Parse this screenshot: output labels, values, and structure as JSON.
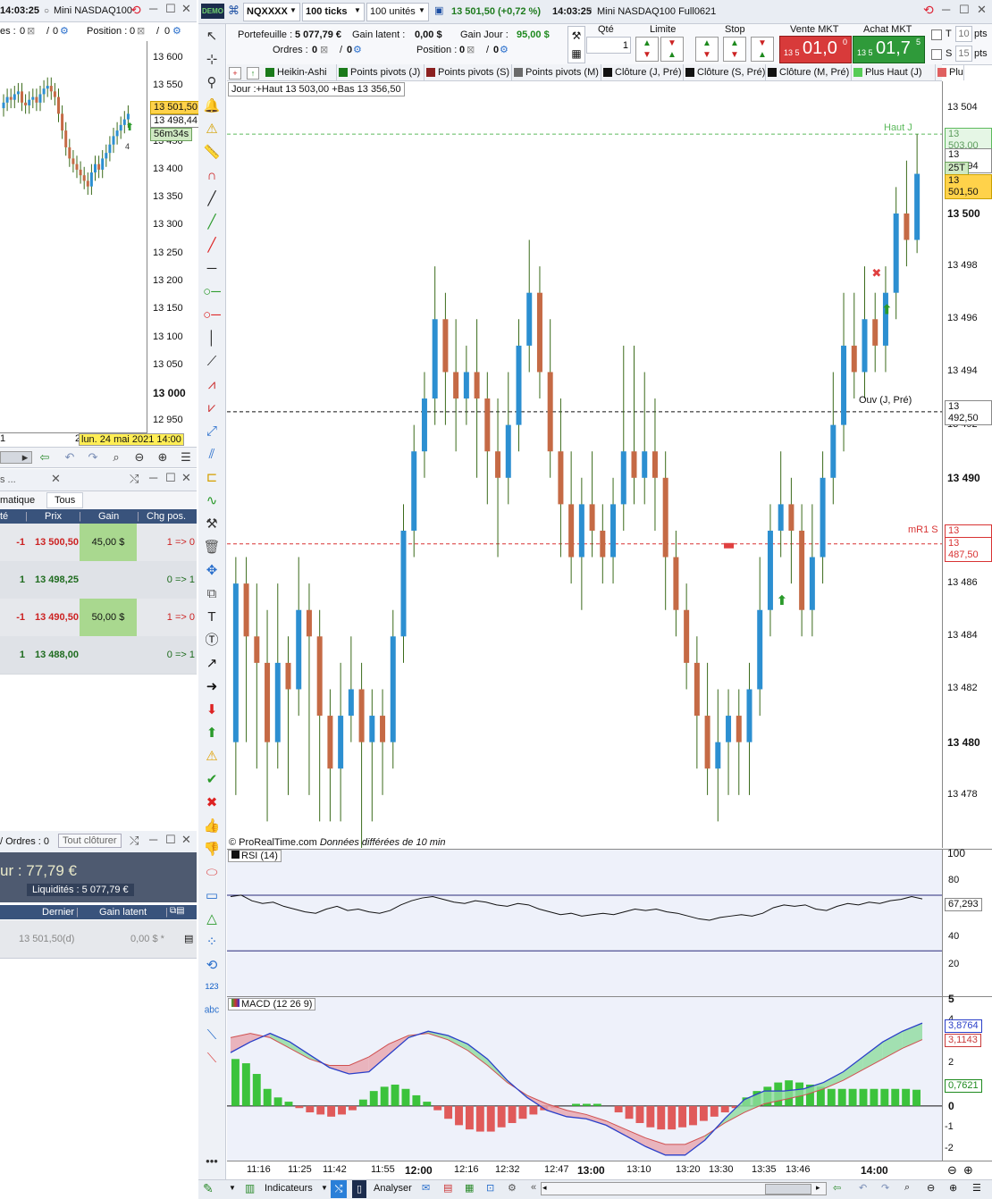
{
  "left_window": {
    "time": "14:03:25",
    "title": "Mini NASDAQ100",
    "orders_label": "es :",
    "orders_val": "0",
    "slash": "/",
    "orders2": "0",
    "position_label": "Position :",
    "position_val": "0",
    "position2": "0",
    "price_labels": [
      "13 600",
      "13 550",
      "13 500",
      "13 450",
      "13 400",
      "13 350",
      "13 300",
      "13 250",
      "13 200",
      "13 150",
      "13 100",
      "13 050",
      "13 000",
      "12 950"
    ],
    "last_price": "13 501,50",
    "ref_price": "13 498,44",
    "countdown": "56m34s",
    "date_badge": "lun. 24 mai 2021 14:00",
    "x_left": "1",
    "x_right": "2",
    "marker_num": "4"
  },
  "trades_panel": {
    "title": "s ...",
    "filter_auto": "matique",
    "filter_all": "Tous",
    "headers": [
      "té",
      "Prix",
      "Gain",
      "Chg pos."
    ],
    "rows": [
      {
        "qty": "-1",
        "price": "13 500,50",
        "gain": "45,00 $",
        "chg": "1 => 0"
      },
      {
        "qty": "1",
        "price": "13 498,25",
        "gain": "",
        "chg": "0 => 1"
      },
      {
        "qty": "-1",
        "price": "13 490,50",
        "gain": "50,00 $",
        "chg": "1 => 0"
      },
      {
        "qty": "1",
        "price": "13 488,00",
        "gain": "",
        "chg": "0 => 1"
      }
    ]
  },
  "positions_panel": {
    "orders_label": "/ Ordres : 0",
    "close_all": "Tout clôturer",
    "day_gain": "ur : 77,79 €",
    "liquidity": "Liquidités : 5 077,79 €",
    "headers": [
      "Dernier",
      "Gain latent"
    ],
    "row": {
      "last": "13 501,50(d)",
      "gain": "0,00 $ *"
    }
  },
  "main_toolbar": {
    "demo": "DEMO",
    "symbol": "NQXXXX",
    "ticks": "100 ticks",
    "units": "100 unités",
    "price_change": "13 501,50 (+0,72 %)",
    "time": "14:03:25",
    "title": "Mini NASDAQ100 Full0621"
  },
  "portfolio": {
    "portefeuille_label": "Portefeuille :",
    "portefeuille_val": "5 077,79 €",
    "gain_latent_label": "Gain latent :",
    "gain_latent_val": "0,00 $",
    "gain_jour_label": "Gain Jour :",
    "gain_jour_val": "95,00 $",
    "ordres_label": "Ordres :",
    "ordres_val": "0",
    "ordres2": "0",
    "position_label": "Position :",
    "position_val": "0",
    "position2": "0",
    "qte_label": "Qté",
    "qte_val": "1",
    "limite_label": "Limite",
    "stop_label": "Stop",
    "vente_label": "Vente MKT",
    "vente_small": "13 5",
    "vente_big": "01,0",
    "vente_sup": "0",
    "achat_label": "Achat MKT",
    "achat_small": "13 5",
    "achat_big": "01,7",
    "achat_sup": "5",
    "t_label": "T",
    "t_val": "10",
    "t_unit": "pts",
    "s_label": "S",
    "s_val": "15",
    "s_unit": "pts"
  },
  "indicator_tabs": [
    "Heikin-Ashi",
    "Points pivots (J)",
    "Points pivots (S)",
    "Points pivots (M)",
    "Clôture (J, Pré)",
    "Clôture (S, Pré)",
    "Clôture (M, Pré)",
    "Plus Haut (J)",
    "Plu"
  ],
  "tab_colors": [
    "#1a7a1a",
    "#1a7a1a",
    "#8b2020",
    "#6b6b6b",
    "#111111",
    "#111111",
    "#111111",
    "#55cc55",
    "#e06060"
  ],
  "main_chart": {
    "info": "Jour :+Haut 13 503,00 +Bas 13 356,50",
    "watermark": "© ProRealTime.com",
    "delay": "Données différées de 10 min",
    "haut_label": "Haut J",
    "ouv_label": "Ouv (J, Pré)",
    "mr1_label": "mR1 S",
    "price_axis": [
      "13 504",
      "13 500",
      "13 498",
      "13 496",
      "13 494",
      "13 492",
      "13 490",
      "13 488",
      "13 486",
      "13 484",
      "13 482",
      "13 480",
      "13 478"
    ],
    "bold_prices": [
      "13 500",
      "13 490",
      "13 480"
    ],
    "badges": {
      "haut": "13 503,00",
      "last": "13 501,94",
      "ticks": "25T",
      "price": "13 501,50",
      "ouv": "13 492,50",
      "mr1a": "13 487,50",
      "mr1b": "13 487,50"
    },
    "time_axis": [
      "11:16",
      "11:25",
      "11:42",
      "11:55",
      "12:00",
      "12:16",
      "12:32",
      "12:47",
      "13:00",
      "13:10",
      "13:20",
      "13:30",
      "13:35",
      "13:46",
      "14:00"
    ],
    "bold_times": [
      "12:00",
      "13:00",
      "14:00"
    ]
  },
  "rsi_panel": {
    "label": "RSI (14)",
    "axis": [
      "100",
      "80",
      "60",
      "40",
      "20"
    ],
    "value": "67,293"
  },
  "macd_panel": {
    "label": "MACD (12 26 9)",
    "axis": [
      "5",
      "4",
      "3",
      "2",
      "1",
      "0",
      "-1",
      "-2"
    ],
    "v1": "3,8764",
    "v2": "3,1143",
    "v3": "0,7621"
  },
  "bottom_bar": {
    "indicators": "Indicateurs",
    "analyze": "Analyser"
  },
  "chart_data": {
    "type": "candlestick",
    "title": "Mini NASDAQ100 Full0621",
    "ylim": [
      13476,
      13505
    ],
    "x_labels": [
      "11:16",
      "11:25",
      "11:42",
      "11:55",
      "12:00",
      "12:16",
      "12:32",
      "12:47",
      "13:00",
      "13:10",
      "13:20",
      "13:30",
      "13:35",
      "13:46",
      "14:00"
    ],
    "levels": {
      "haut_j": 13503.0,
      "ouv_j_pre": 13492.5,
      "mr1_s": 13487.5
    },
    "candles": [
      {
        "o": 13480,
        "c": 13486,
        "h": 13487,
        "l": 13478
      },
      {
        "o": 13486,
        "c": 13484,
        "h": 13487,
        "l": 13480
      },
      {
        "o": 13484,
        "c": 13483,
        "h": 13486,
        "l": 13479
      },
      {
        "o": 13483,
        "c": 13480,
        "h": 13485,
        "l": 13477
      },
      {
        "o": 13480,
        "c": 13483,
        "h": 13486,
        "l": 13479
      },
      {
        "o": 13483,
        "c": 13482,
        "h": 13484,
        "l": 13478
      },
      {
        "o": 13482,
        "c": 13485,
        "h": 13487,
        "l": 13481
      },
      {
        "o": 13485,
        "c": 13484,
        "h": 13486,
        "l": 13478
      },
      {
        "o": 13484,
        "c": 13481,
        "h": 13485,
        "l": 13477
      },
      {
        "o": 13481,
        "c": 13479,
        "h": 13482,
        "l": 13477
      },
      {
        "o": 13479,
        "c": 13481,
        "h": 13483,
        "l": 13477
      },
      {
        "o": 13481,
        "c": 13482,
        "h": 13484,
        "l": 13480
      },
      {
        "o": 13482,
        "c": 13480,
        "h": 13483,
        "l": 13476
      },
      {
        "o": 13480,
        "c": 13481,
        "h": 13482,
        "l": 13477
      },
      {
        "o": 13481,
        "c": 13480,
        "h": 13482,
        "l": 13478
      },
      {
        "o": 13480,
        "c": 13484,
        "h": 13485,
        "l": 13479
      },
      {
        "o": 13484,
        "c": 13488,
        "h": 13489,
        "l": 13483
      },
      {
        "o": 13488,
        "c": 13491,
        "h": 13492,
        "l": 13487
      },
      {
        "o": 13491,
        "c": 13493,
        "h": 13494,
        "l": 13490
      },
      {
        "o": 13493,
        "c": 13496,
        "h": 13498,
        "l": 13492
      },
      {
        "o": 13496,
        "c": 13494,
        "h": 13497,
        "l": 13492
      },
      {
        "o": 13494,
        "c": 13493,
        "h": 13496,
        "l": 13491
      },
      {
        "o": 13493,
        "c": 13494,
        "h": 13495,
        "l": 13492
      },
      {
        "o": 13494,
        "c": 13493,
        "h": 13496,
        "l": 13490
      },
      {
        "o": 13493,
        "c": 13491,
        "h": 13494,
        "l": 13489
      },
      {
        "o": 13491,
        "c": 13490,
        "h": 13493,
        "l": 13487
      },
      {
        "o": 13490,
        "c": 13492,
        "h": 13494,
        "l": 13489
      },
      {
        "o": 13492,
        "c": 13495,
        "h": 13496,
        "l": 13491
      },
      {
        "o": 13495,
        "c": 13497,
        "h": 13499,
        "l": 13494
      },
      {
        "o": 13497,
        "c": 13494,
        "h": 13498,
        "l": 13493
      },
      {
        "o": 13494,
        "c": 13491,
        "h": 13496,
        "l": 13490
      },
      {
        "o": 13491,
        "c": 13489,
        "h": 13493,
        "l": 13487
      },
      {
        "o": 13489,
        "c": 13487,
        "h": 13491,
        "l": 13486
      },
      {
        "o": 13487,
        "c": 13489,
        "h": 13490,
        "l": 13485
      },
      {
        "o": 13489,
        "c": 13488,
        "h": 13491,
        "l": 13487
      },
      {
        "o": 13488,
        "c": 13487,
        "h": 13489,
        "l": 13486
      },
      {
        "o": 13487,
        "c": 13489,
        "h": 13490,
        "l": 13486
      },
      {
        "o": 13489,
        "c": 13491,
        "h": 13495,
        "l": 13488
      },
      {
        "o": 13491,
        "c": 13490,
        "h": 13495,
        "l": 13489
      },
      {
        "o": 13490,
        "c": 13491,
        "h": 13494,
        "l": 13489
      },
      {
        "o": 13491,
        "c": 13490,
        "h": 13493,
        "l": 13488
      },
      {
        "o": 13490,
        "c": 13487,
        "h": 13491,
        "l": 13485
      },
      {
        "o": 13487,
        "c": 13485,
        "h": 13488,
        "l": 13484
      },
      {
        "o": 13485,
        "c": 13483,
        "h": 13486,
        "l": 13482
      },
      {
        "o": 13483,
        "c": 13481,
        "h": 13484,
        "l": 13479
      },
      {
        "o": 13481,
        "c": 13479,
        "h": 13483,
        "l": 13478
      },
      {
        "o": 13479,
        "c": 13480,
        "h": 13482,
        "l": 13477
      },
      {
        "o": 13480,
        "c": 13481,
        "h": 13482,
        "l": 13478
      },
      {
        "o": 13481,
        "c": 13480,
        "h": 13482,
        "l": 13478
      },
      {
        "o": 13480,
        "c": 13482,
        "h": 13483,
        "l": 13478
      },
      {
        "o": 13482,
        "c": 13485,
        "h": 13487,
        "l": 13481
      },
      {
        "o": 13485,
        "c": 13488,
        "h": 13489,
        "l": 13484
      },
      {
        "o": 13488,
        "c": 13489,
        "h": 13491,
        "l": 13487
      },
      {
        "o": 13489,
        "c": 13488,
        "h": 13490,
        "l": 13486
      },
      {
        "o": 13488,
        "c": 13485,
        "h": 13489,
        "l": 13484
      },
      {
        "o": 13485,
        "c": 13487,
        "h": 13489,
        "l": 13484
      },
      {
        "o": 13487,
        "c": 13490,
        "h": 13491,
        "l": 13486
      },
      {
        "o": 13490,
        "c": 13492,
        "h": 13494,
        "l": 13489
      },
      {
        "o": 13492,
        "c": 13495,
        "h": 13497,
        "l": 13491
      },
      {
        "o": 13495,
        "c": 13494,
        "h": 13497,
        "l": 13493
      },
      {
        "o": 13494,
        "c": 13496,
        "h": 13498,
        "l": 13493
      },
      {
        "o": 13496,
        "c": 13495,
        "h": 13497,
        "l": 13494
      },
      {
        "o": 13495,
        "c": 13497,
        "h": 13498,
        "l": 13494
      },
      {
        "o": 13497,
        "c": 13500,
        "h": 13501,
        "l": 13496
      },
      {
        "o": 13500,
        "c": 13499,
        "h": 13502,
        "l": 13498
      },
      {
        "o": 13499,
        "c": 13501.5,
        "h": 13503,
        "l": 13498.5
      }
    ],
    "rsi": {
      "ylim": [
        0,
        100
      ],
      "values": [
        69,
        70,
        66,
        64,
        65,
        62,
        60,
        58,
        57,
        60,
        62,
        59,
        60,
        58,
        57,
        59,
        63,
        66,
        68,
        69,
        67,
        65,
        64,
        66,
        65,
        63,
        62,
        64,
        63,
        60,
        58,
        56,
        57,
        55,
        56,
        57,
        56,
        58,
        60,
        59,
        60,
        58,
        57,
        55,
        53,
        52,
        54,
        55,
        56,
        55,
        57,
        61,
        63,
        62,
        63,
        60,
        59,
        62,
        64,
        63,
        65,
        64,
        66,
        67,
        69,
        67.3
      ]
    },
    "macd": {
      "ylim": [
        -2.5,
        5
      ],
      "histogram": [
        2.2,
        2.0,
        1.5,
        0.8,
        0.4,
        0.2,
        -0.1,
        -0.3,
        -0.4,
        -0.5,
        -0.4,
        -0.2,
        0.3,
        0.7,
        0.9,
        1.0,
        0.8,
        0.5,
        0.2,
        -0.2,
        -0.6,
        -0.9,
        -1.1,
        -1.2,
        -1.2,
        -1.0,
        -0.8,
        -0.6,
        -0.4,
        -0.2,
        -0.1,
        0.0,
        0.1,
        0.1,
        0.1,
        0.0,
        -0.3,
        -0.6,
        -0.8,
        -1.0,
        -1.1,
        -1.1,
        -1.0,
        -0.9,
        -0.7,
        -0.5,
        -0.3,
        -0.1,
        0.4,
        0.7,
        0.9,
        1.1,
        1.2,
        1.1,
        1.0,
        0.9,
        0.8,
        0.8,
        0.8,
        0.8,
        0.8,
        0.8,
        0.8,
        0.8,
        0.76
      ],
      "macd_line": [
        2.5,
        3.0,
        3.4,
        3.0,
        2.4,
        1.8,
        1.5,
        1.6,
        2.4,
        3.2,
        3.5,
        3.3,
        2.9,
        2.2,
        1.2,
        0.4,
        -0.2,
        -0.5,
        -0.6,
        -0.9,
        -1.4,
        -1.9,
        -2.3,
        -2.3,
        -1.6,
        -0.6,
        0.3,
        0.7,
        0.7,
        0.8,
        1.1,
        1.6,
        2.3,
        3.0,
        3.5,
        3.88
      ],
      "signal_line": [
        3.2,
        3.4,
        3.2,
        2.7,
        2.2,
        1.9,
        1.9,
        2.3,
        2.9,
        3.3,
        3.4,
        3.1,
        2.6,
        1.9,
        1.1,
        0.5,
        0.1,
        -0.2,
        -0.4,
        -0.7,
        -1.1,
        -1.5,
        -1.8,
        -1.8,
        -1.4,
        -0.8,
        -0.3,
        0.1,
        0.3,
        0.5,
        0.8,
        1.2,
        1.7,
        2.2,
        2.7,
        3.11
      ]
    }
  }
}
